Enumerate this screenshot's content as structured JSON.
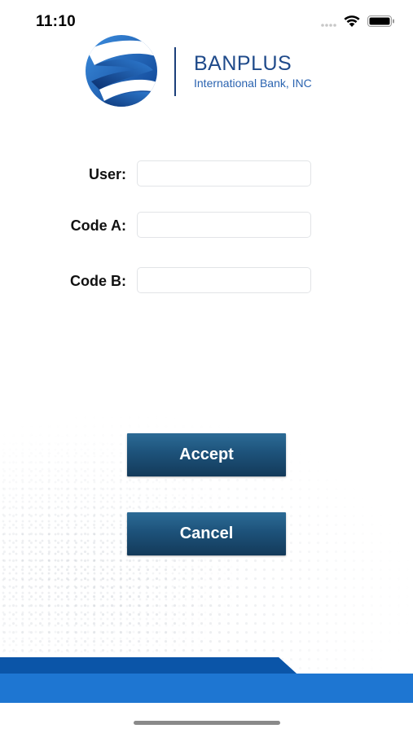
{
  "status_bar": {
    "time": "11:10"
  },
  "logo": {
    "name": "BANPLUS",
    "subtitle": "International Bank, INC"
  },
  "form": {
    "user_label": "User:",
    "user_value": "",
    "code_a_label": "Code A:",
    "code_a_value": "",
    "code_b_label": "Code B:",
    "code_b_value": ""
  },
  "buttons": {
    "accept_label": "Accept",
    "cancel_label": "Cancel"
  },
  "colors": {
    "button": "#1d527a",
    "brand_blue": "#1f4a8a",
    "band_dark": "#0b55a8",
    "band_light": "#1e76d2"
  },
  "icons": [
    "cellular-signal-icon",
    "wifi-icon",
    "battery-icon",
    "banplus-logo-icon"
  ]
}
